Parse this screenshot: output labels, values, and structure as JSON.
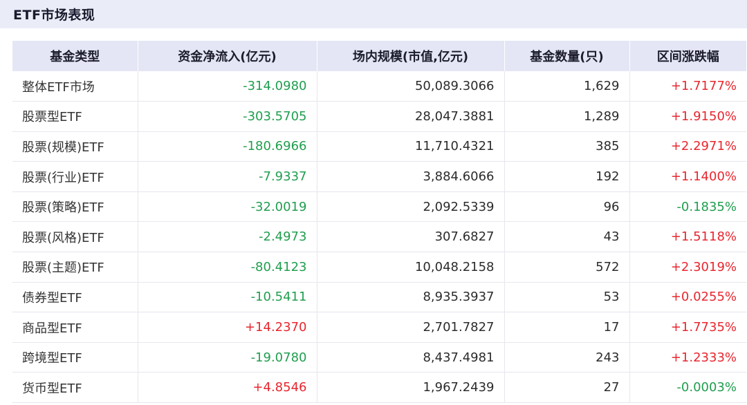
{
  "title": "ETF市场表现",
  "colors": {
    "positive": "#e8262e",
    "negative": "#1f9e4e",
    "header_bg": "#e4e6f5",
    "title_bar_bg": "#eaedf7"
  },
  "table": {
    "headers": [
      "基金类型",
      "资金净流入(亿元)",
      "场内规模(市值,亿元)",
      "基金数量(只)",
      "区间涨跌幅"
    ],
    "rows": [
      {
        "category": "整体ETF市场",
        "net_inflow": "-314.0980",
        "scale": "50,089.3066",
        "count": "1,629",
        "change": "+1.7177%"
      },
      {
        "category": "股票型ETF",
        "net_inflow": "-303.5705",
        "scale": "28,047.3881",
        "count": "1,289",
        "change": "+1.9150%"
      },
      {
        "category": "股票(规模)ETF",
        "net_inflow": "-180.6966",
        "scale": "11,710.4321",
        "count": "385",
        "change": "+2.2971%"
      },
      {
        "category": "股票(行业)ETF",
        "net_inflow": "-7.9337",
        "scale": "3,884.6066",
        "count": "192",
        "change": "+1.1400%"
      },
      {
        "category": "股票(策略)ETF",
        "net_inflow": "-32.0019",
        "scale": "2,092.5339",
        "count": "96",
        "change": "-0.1835%"
      },
      {
        "category": "股票(风格)ETF",
        "net_inflow": "-2.4973",
        "scale": "307.6827",
        "count": "43",
        "change": "+1.5118%"
      },
      {
        "category": "股票(主题)ETF",
        "net_inflow": "-80.4123",
        "scale": "10,048.2158",
        "count": "572",
        "change": "+2.3019%"
      },
      {
        "category": "债券型ETF",
        "net_inflow": "-10.5411",
        "scale": "8,935.3937",
        "count": "53",
        "change": "+0.0255%"
      },
      {
        "category": "商品型ETF",
        "net_inflow": "+14.2370",
        "scale": "2,701.7827",
        "count": "17",
        "change": "+1.7735%"
      },
      {
        "category": "跨境型ETF",
        "net_inflow": "-19.0780",
        "scale": "8,437.4981",
        "count": "243",
        "change": "+1.2333%"
      },
      {
        "category": "货币型ETF",
        "net_inflow": "+4.8546",
        "scale": "1,967.2439",
        "count": "27",
        "change": "-0.0003%"
      }
    ]
  }
}
